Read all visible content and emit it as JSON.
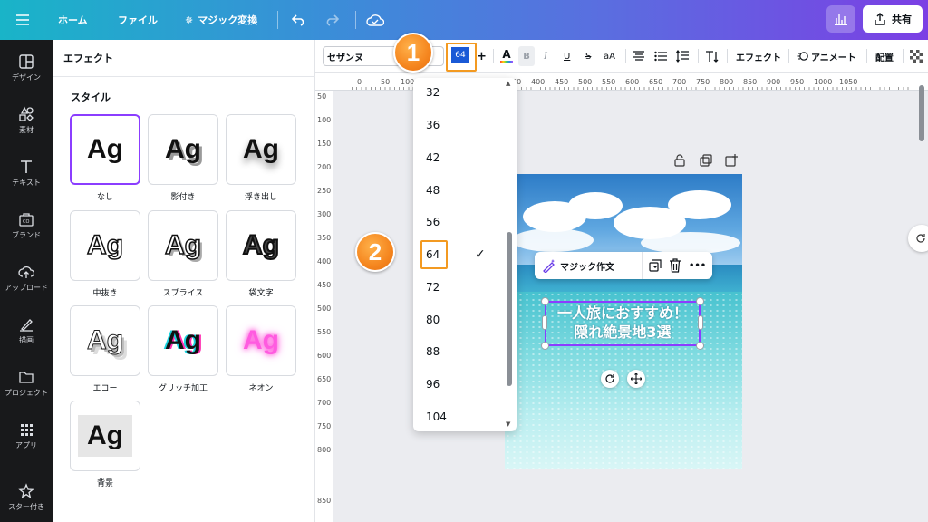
{
  "topbar": {
    "home": "ホーム",
    "file": "ファイル",
    "magic_switch": "マジック変換",
    "share": "共有"
  },
  "rail": [
    {
      "label": "デザイン",
      "icon": "design-icon"
    },
    {
      "label": "素材",
      "icon": "elements-icon"
    },
    {
      "label": "テキスト",
      "icon": "text-icon"
    },
    {
      "label": "ブランド",
      "icon": "brand-icon"
    },
    {
      "label": "アップロード",
      "icon": "upload-icon"
    },
    {
      "label": "描画",
      "icon": "draw-icon"
    },
    {
      "label": "プロジェクト",
      "icon": "folder-icon"
    },
    {
      "label": "アプリ",
      "icon": "apps-icon"
    },
    {
      "label": "スター付き",
      "icon": "star-icon"
    }
  ],
  "panel": {
    "title": "エフェクト",
    "section": "スタイル",
    "sample": "Ag",
    "styles": [
      "なし",
      "影付き",
      "浮き出し",
      "中抜き",
      "スプライス",
      "袋文字",
      "エコー",
      "グリッチ加工",
      "ネオン",
      "背景"
    ]
  },
  "toolbar": {
    "font": "セザンヌ",
    "size": "64",
    "plus": "+",
    "bold": "B",
    "italic": "I",
    "underline": "U",
    "strike": "S",
    "case": "aA",
    "effects": "エフェクト",
    "animate": "アニメート",
    "position": "配置"
  },
  "ruler": {
    "top": [
      "0",
      "50",
      "100",
      "350",
      "400",
      "450",
      "500",
      "550",
      "600",
      "650",
      "700",
      "750",
      "800",
      "850",
      "900",
      "950",
      "1000",
      "1050"
    ],
    "left": [
      "50",
      "100",
      "150",
      "200",
      "250",
      "300",
      "350",
      "400",
      "450",
      "500",
      "550",
      "600",
      "650",
      "700",
      "750",
      "800",
      "850"
    ]
  },
  "dropdown": {
    "sizes": [
      "32",
      "36",
      "42",
      "48",
      "56",
      "64",
      "72",
      "80",
      "88",
      "96",
      "104"
    ],
    "selected": "64",
    "check": "✓"
  },
  "canvas": {
    "line1": "一人旅におすすめ！",
    "line2": "隠れ絶景地3選",
    "context_action": "マジック作文",
    "more": "•••"
  },
  "annotations": {
    "badge1": "1",
    "badge2": "2",
    "color": "#f39a21"
  },
  "colors": {
    "accent": "#8b3dff",
    "text_select": "#1a59d6"
  }
}
